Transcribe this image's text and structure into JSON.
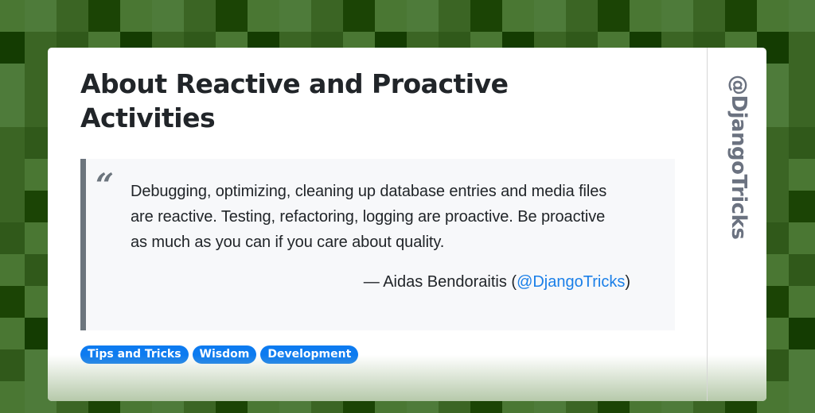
{
  "post": {
    "title": "About Reactive and Proactive Activities",
    "quote": {
      "mark": "“",
      "text": "Debugging, optimizing, cleaning up database entries and media files are reactive. Testing, refactoring, logging are proactive. Be proactive as much as you can if you care about quality.",
      "attribution_prefix": "— Aidas Bendoraitis (",
      "attribution_handle": "@DjangoTricks",
      "attribution_suffix": ")"
    },
    "tags": [
      "Tips and Tricks",
      "Wisdom",
      "Development"
    ]
  },
  "sidebar": {
    "handle": "@DjangoTricks"
  },
  "colors": {
    "title": "#212529",
    "tag_bg": "#0d7bf0",
    "link": "#1a7fe8",
    "quote_border": "#6c757d",
    "quote_bg": "#f7f8fa",
    "background_palette": [
      "#4a7733",
      "#4e7b3a",
      "#3b6524",
      "#1b4405",
      "#30591a",
      "#143c02"
    ]
  }
}
